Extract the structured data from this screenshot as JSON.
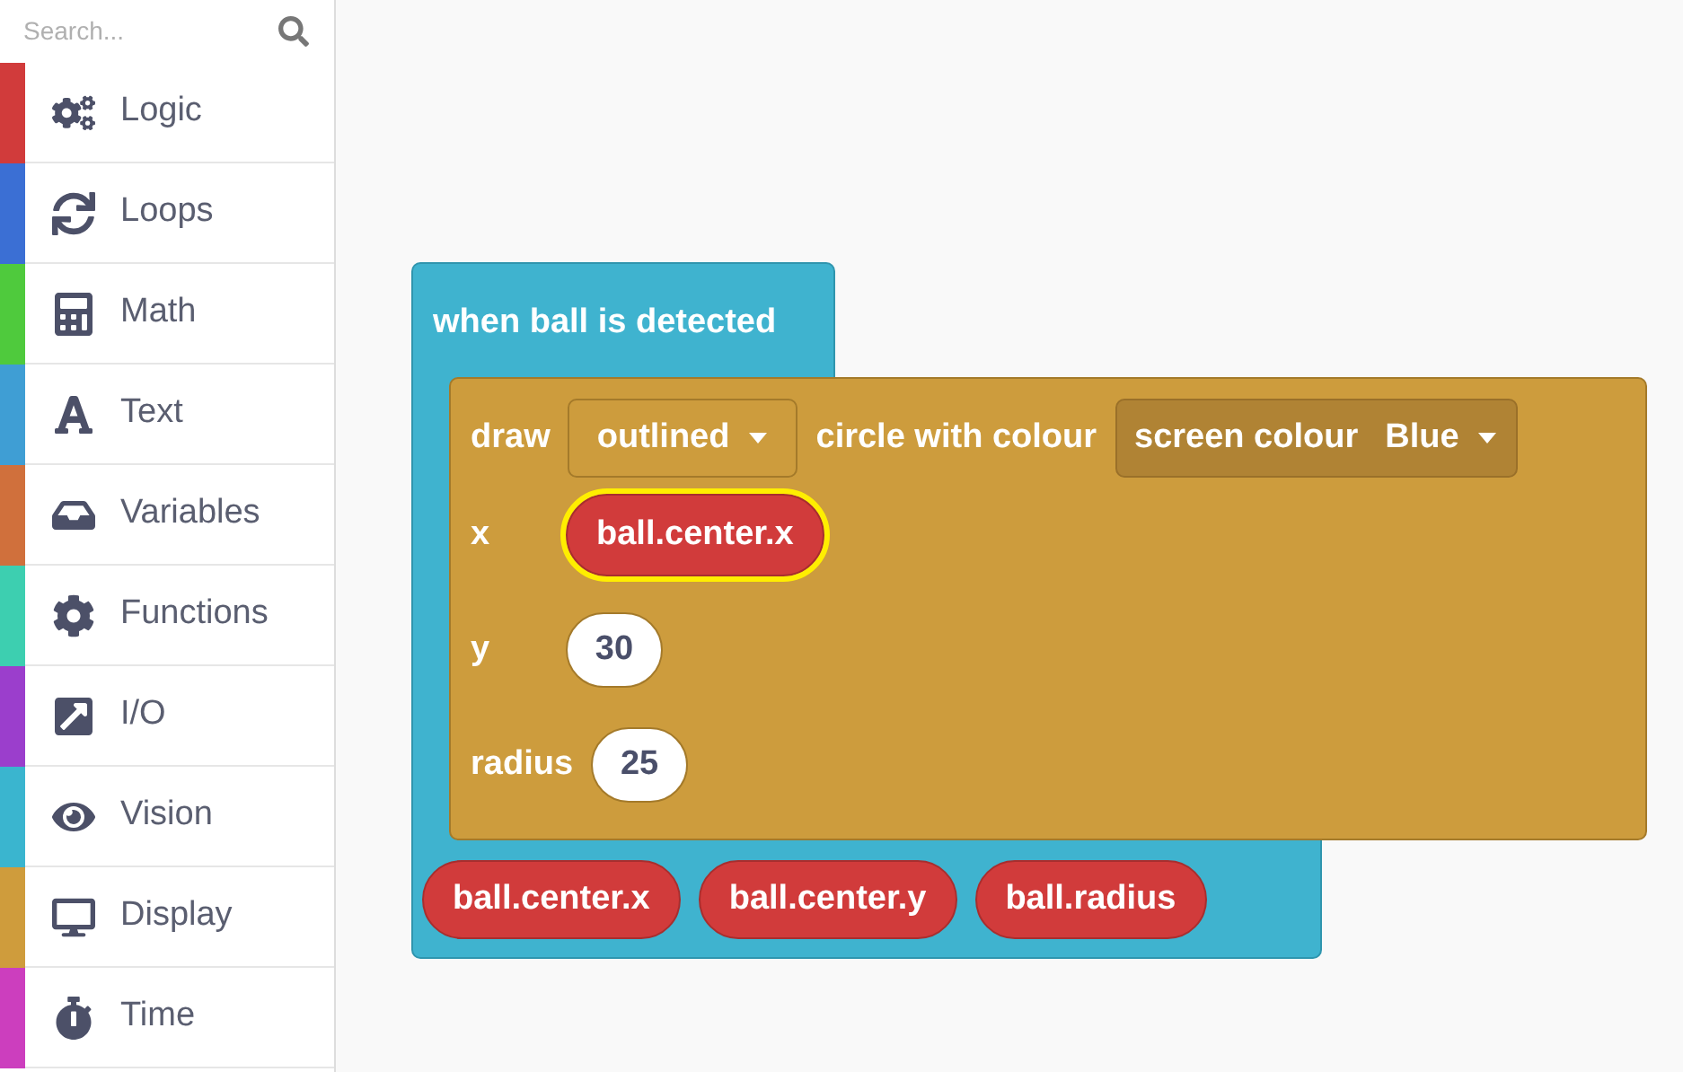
{
  "sidebar": {
    "search": {
      "placeholder": "Search..."
    },
    "categories": [
      {
        "label": "Logic",
        "color": "#d13b3b"
      },
      {
        "label": "Loops",
        "color": "#3b6fd4"
      },
      {
        "label": "Math",
        "color": "#4fca3d"
      },
      {
        "label": "Text",
        "color": "#3f9ed4"
      },
      {
        "label": "Variables",
        "color": "#d0703c"
      },
      {
        "label": "Functions",
        "color": "#3dcfb0"
      },
      {
        "label": "I/O",
        "color": "#9b3ecc"
      },
      {
        "label": "Vision",
        "color": "#3ab5cf"
      },
      {
        "label": "Display",
        "color": "#cf9c3c"
      },
      {
        "label": "Time",
        "color": "#cc3ebe"
      }
    ]
  },
  "canvas": {
    "event_block": {
      "title": "when ball is detected",
      "statement": {
        "verb": "draw",
        "style": "outlined",
        "middle": "circle with colour",
        "colour_label": "screen colour",
        "colour": "Blue",
        "inputs": [
          {
            "label": "x",
            "kind": "variable",
            "value": "ball.center.x",
            "selected": true
          },
          {
            "label": "y",
            "kind": "number",
            "value": "30",
            "selected": false
          },
          {
            "label": "radius",
            "kind": "number",
            "value": "25",
            "selected": false
          }
        ]
      },
      "arguments": [
        {
          "name": "ball.center.x"
        },
        {
          "name": "ball.center.y"
        },
        {
          "name": "ball.radius"
        }
      ]
    }
  }
}
